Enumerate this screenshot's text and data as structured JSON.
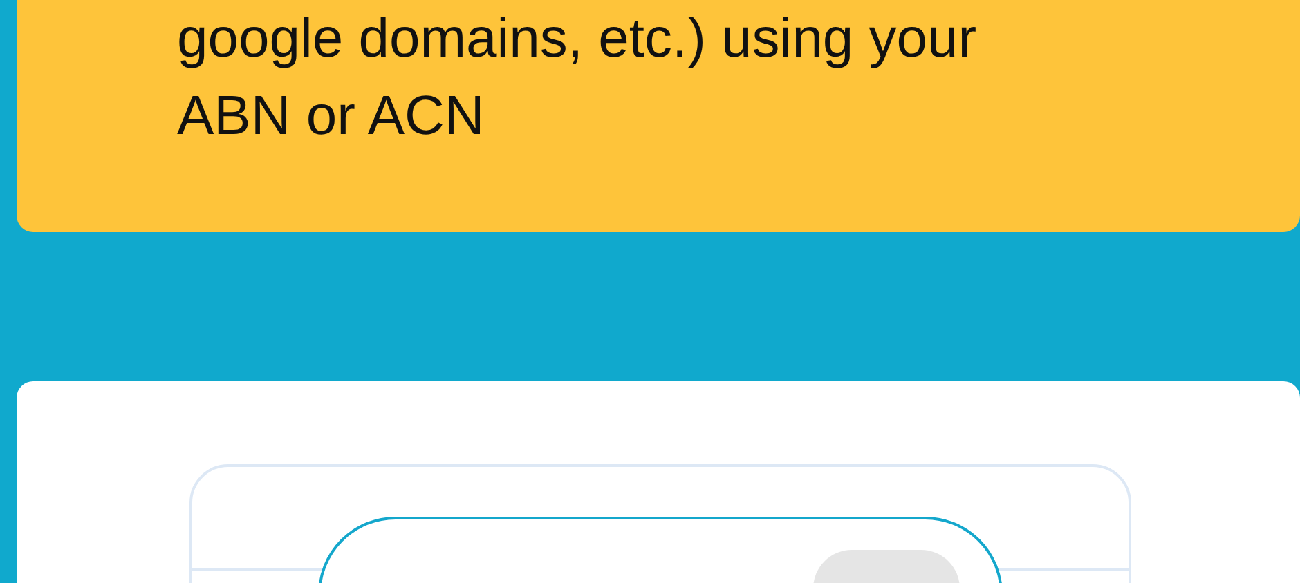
{
  "notice": {
    "text": "google domains, etc.) using your ABN or ACN"
  }
}
